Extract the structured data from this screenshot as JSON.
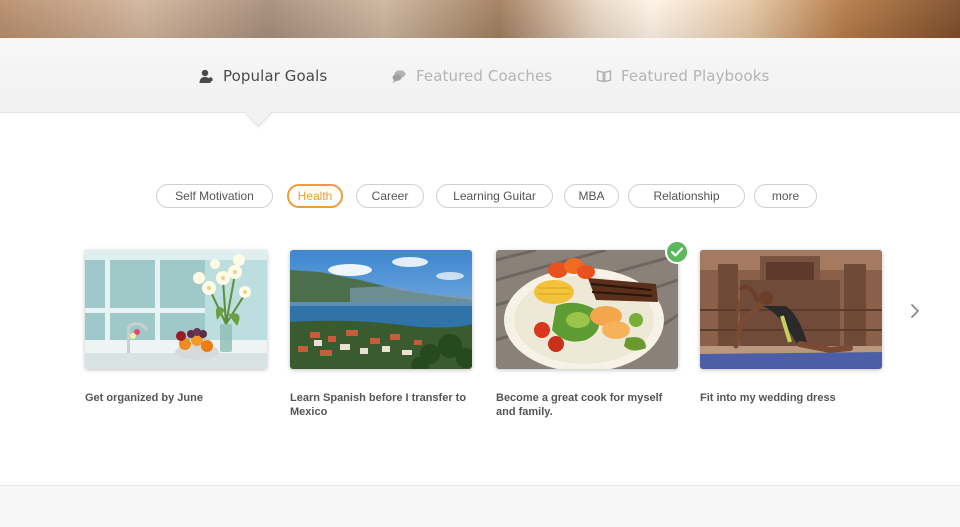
{
  "tabs": [
    {
      "label": "Popular Goals",
      "icon": "person-icon",
      "active": true
    },
    {
      "label": "Featured Coaches",
      "icon": "chat-bubble-icon",
      "active": false
    },
    {
      "label": "Featured Playbooks",
      "icon": "book-icon",
      "active": false
    }
  ],
  "categories": [
    {
      "label": "Self Motivation",
      "active": false
    },
    {
      "label": "Health",
      "active": true
    },
    {
      "label": "Career",
      "active": false
    },
    {
      "label": "Learning Guitar",
      "active": false
    },
    {
      "label": "MBA",
      "active": false
    },
    {
      "label": "Relationship",
      "active": false
    },
    {
      "label": "more",
      "active": false
    }
  ],
  "goals": [
    {
      "title": "Get organized by June",
      "image": "flowers-fruit-kitchen"
    },
    {
      "title": "Learn Spanish before I transfer to Mexico",
      "image": "lake-town-mountains"
    },
    {
      "title": "Become a great cook for myself and family.",
      "image": "grilled-meal-plate",
      "completed": true
    },
    {
      "title": "Fit into my wedding dress",
      "image": "yoga-pose"
    }
  ],
  "icons": {
    "next": "chevron-right-icon",
    "check": "check-icon"
  },
  "colors": {
    "accent": "#f29a36",
    "check": "#5cb85c",
    "text_dark": "#4a4a4a",
    "text_muted": "#b4b4b4"
  }
}
